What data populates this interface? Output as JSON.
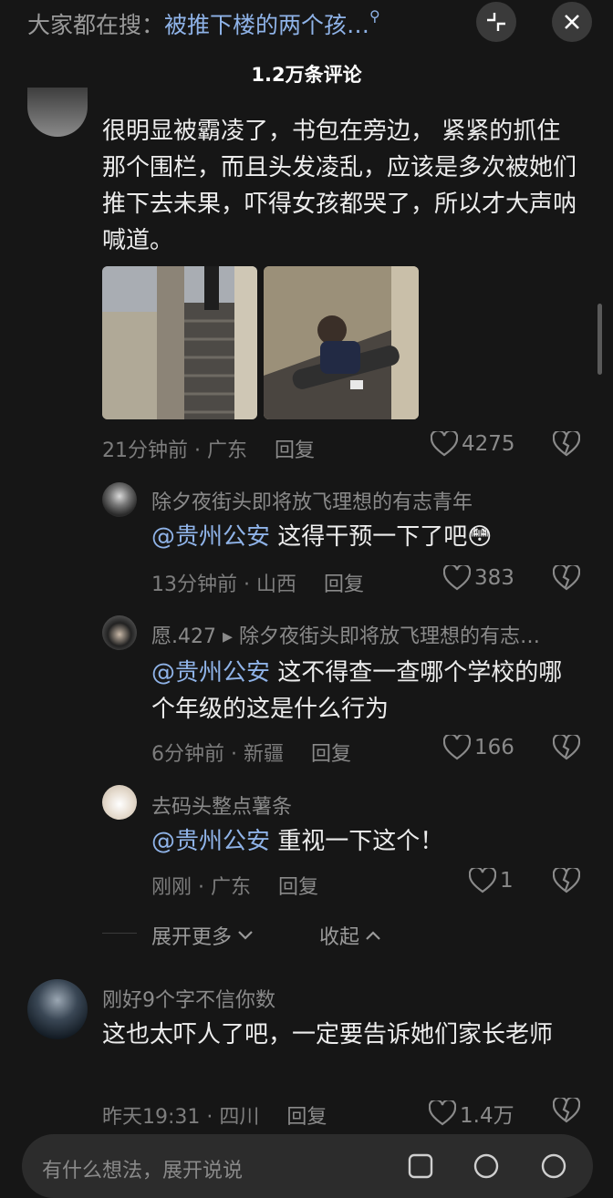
{
  "header": {
    "search_prefix": "大家都在搜：",
    "search_query": "被推下楼的两个孩…",
    "comment_count": "1.2万条评论"
  },
  "comment_main": {
    "text": "很明显被霸凌了，书包在旁边， 紧紧的抓住那个围栏，而且头发凌乱，应该是多次被她们推下去未果，吓得女孩都哭了，所以才大声呐喊道。",
    "meta": "21分钟前 · 广东",
    "reply_label": "回复",
    "likes": "4275"
  },
  "replies": [
    {
      "name": "除夕夜街头即将放飞理想的有志青年",
      "mention": "@贵州公安",
      "text": " 这得干预一下了吧",
      "emoji": "😳",
      "meta": "13分钟前 · 山西",
      "reply_label": "回复",
      "likes": "383"
    },
    {
      "name": "愿.427 ▸ 除夕夜街头即将放飞理想的有志…",
      "mention": "@贵州公安",
      "text": " 这不得查一查哪个学校的哪个年级的这是什么行为",
      "meta": "6分钟前 · 新疆",
      "reply_label": "回复",
      "likes": "166"
    },
    {
      "name": "去码头整点薯条",
      "mention": "@贵州公安",
      "text": " 重视一下这个！",
      "meta": "刚刚 · 广东",
      "reply_label": "回复",
      "likes": "1"
    }
  ],
  "thread_controls": {
    "expand_label": "展开更多",
    "collapse_label": "收起"
  },
  "comment_second": {
    "name": "刚好9个字不信你数",
    "text": "这也太吓人了吧，一定要告诉她们家长老师",
    "meta": "昨天19:31 · 四川",
    "reply_label": "回复",
    "likes": "1.4万"
  },
  "input": {
    "placeholder": "有什么想法，展开说说"
  },
  "colors": {
    "background": "#161616",
    "link": "#8fb3e8",
    "muted": "#7d7d7d"
  }
}
